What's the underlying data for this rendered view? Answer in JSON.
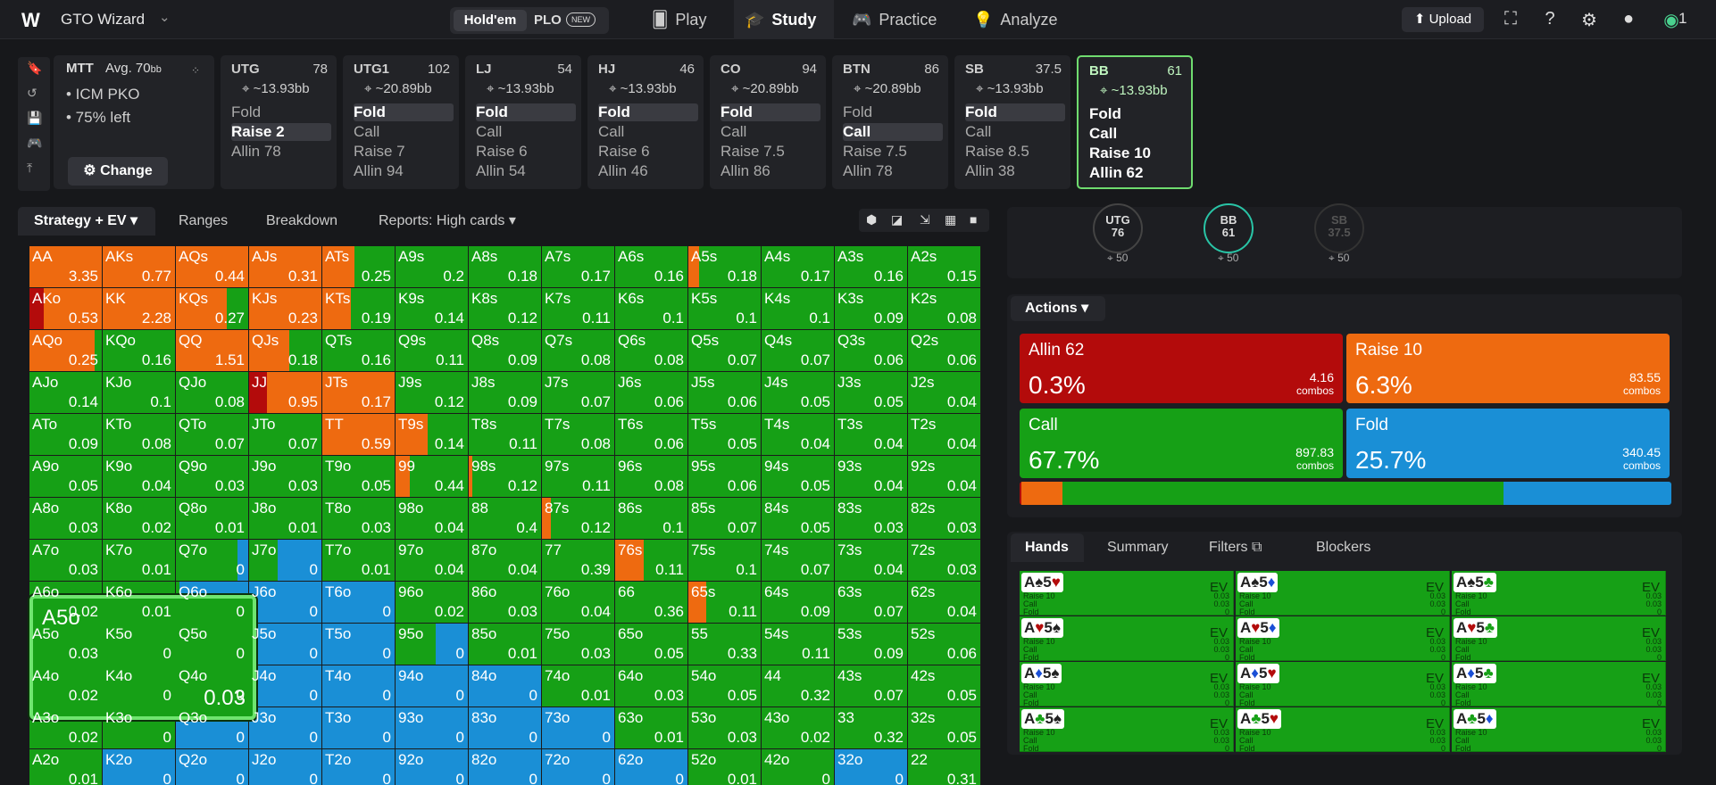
{
  "topbar": {
    "app_name": "GTO Wizard",
    "logo": "W",
    "game_holdem": "Hold'em",
    "game_plo": "PLO",
    "new_badge": "NEW",
    "nav": [
      {
        "label": "Play",
        "icon": "🂠"
      },
      {
        "label": "Study",
        "icon": "🎓"
      },
      {
        "label": "Practice",
        "icon": "🎮"
      },
      {
        "label": "Analyze",
        "icon": "💡"
      }
    ],
    "upload": "Upload",
    "coin_count": "1"
  },
  "mtt": {
    "title": "MTT",
    "avg_label": "Avg. 70",
    "avg_unit": "bb",
    "line1": "• ICM PKO",
    "line2": "• 75% left",
    "change": "Change"
  },
  "seats": [
    {
      "name": "UTG",
      "stack": "78",
      "bb": "~13.93bb",
      "actions": [
        "Fold",
        "Raise 2",
        "Allin 78"
      ],
      "selected": 1
    },
    {
      "name": "UTG1",
      "stack": "102",
      "bb": "~20.89bb",
      "actions": [
        "Fold",
        "Call",
        "Raise 7",
        "Allin 94"
      ],
      "selected": 0
    },
    {
      "name": "LJ",
      "stack": "54",
      "bb": "~13.93bb",
      "actions": [
        "Fold",
        "Call",
        "Raise 6",
        "Allin 54"
      ],
      "selected": 0
    },
    {
      "name": "HJ",
      "stack": "46",
      "bb": "~13.93bb",
      "actions": [
        "Fold",
        "Call",
        "Raise 6",
        "Allin 46"
      ],
      "selected": 0
    },
    {
      "name": "CO",
      "stack": "94",
      "bb": "~20.89bb",
      "actions": [
        "Fold",
        "Call",
        "Raise 7.5",
        "Allin 86"
      ],
      "selected": 0
    },
    {
      "name": "BTN",
      "stack": "86",
      "bb": "~20.89bb",
      "actions": [
        "Fold",
        "Call",
        "Raise 7.5",
        "Allin 78"
      ],
      "selected": 1
    },
    {
      "name": "SB",
      "stack": "37.5",
      "bb": "~13.93bb",
      "actions": [
        "Fold",
        "Call",
        "Raise 8.5",
        "Allin 38"
      ],
      "selected": 0
    },
    {
      "name": "BB",
      "stack": "61",
      "bb": "~13.93bb",
      "actions": [
        "Fold",
        "Call",
        "Raise 10",
        "Allin 62"
      ],
      "selected": -1
    }
  ],
  "tabs": [
    "Strategy + EV",
    "Ranges",
    "Breakdown",
    "Reports: High cards"
  ],
  "colors": {
    "allin": "#b30b0b",
    "raise": "#ee6a10",
    "call": "#16a016",
    "fold": "#1a8fd6"
  },
  "grid": [
    [
      "AA|3.35|R",
      "AKs|0.77|R",
      "AQs|0.44|R",
      "AJs|0.31|R",
      "ATs|0.25|R:0.45,C:0.55",
      "A9s|0.2|C",
      "A8s|0.18|C",
      "A7s|0.17|C",
      "A6s|0.16|C",
      "A5s|0.18|R:0.15,C:0.85",
      "A4s|0.17|C",
      "A3s|0.16|C",
      "A2s|0.15|C"
    ],
    [
      "AKo|0.53|A:0.2,R:0.8",
      "KK|2.28|R",
      "KQs|0.27|R:0.7,C:0.3",
      "KJs|0.23|R",
      "KTs|0.19|R:0.4,C:0.6",
      "K9s|0.14|C",
      "K8s|0.12|C",
      "K7s|0.11|C",
      "K6s|0.1|C",
      "K5s|0.1|C",
      "K4s|0.1|C",
      "K3s|0.09|C",
      "K2s|0.08|C"
    ],
    [
      "AQo|0.25|R:0.9,C:0.1",
      "KQo|0.16|C",
      "QQ|1.51|R",
      "QJs|0.18|R:0.55,C:0.45",
      "QTs|0.16|C",
      "Q9s|0.11|C",
      "Q8s|0.09|C",
      "Q7s|0.08|C",
      "Q6s|0.08|C",
      "Q5s|0.07|C",
      "Q4s|0.07|C",
      "Q3s|0.06|C",
      "Q2s|0.06|C"
    ],
    [
      "AJo|0.14|C",
      "KJo|0.1|C",
      "QJo|0.08|C",
      "JJ|0.95|A:0.25,R:0.75",
      "JTs|0.17|R",
      "J9s|0.12|C",
      "J8s|0.09|C",
      "J7s|0.07|C",
      "J6s|0.06|C",
      "J5s|0.06|C",
      "J4s|0.05|C",
      "J3s|0.05|C",
      "J2s|0.04|C"
    ],
    [
      "ATo|0.09|C",
      "KTo|0.08|C",
      "QTo|0.07|C",
      "JTo|0.07|C",
      "TT|0.59|R",
      "T9s|0.14|R:0.45,C:0.55",
      "T8s|0.11|C",
      "T7s|0.08|C",
      "T6s|0.06|C",
      "T5s|0.05|C",
      "T4s|0.04|C",
      "T3s|0.04|C",
      "T2s|0.04|C"
    ],
    [
      "A9o|0.05|C",
      "K9o|0.04|C",
      "Q9o|0.03|C",
      "J9o|0.03|C",
      "T9o|0.05|C",
      "99|0.44|R:0.2,C:0.8",
      "98s|0.12|R:0.05,C:0.95",
      "97s|0.11|C",
      "96s|0.08|C",
      "95s|0.06|C",
      "94s|0.05|C",
      "93s|0.04|C",
      "92s|0.04|C"
    ],
    [
      "A8o|0.03|C",
      "K8o|0.02|C",
      "Q8o|0.01|C",
      "J8o|0.01|C",
      "T8o|0.03|C",
      "98o|0.04|C",
      "88|0.4|C",
      "87s|0.12|R:0.12,C:0.88",
      "86s|0.1|C",
      "85s|0.07|C",
      "84s|0.05|C",
      "83s|0.03|C",
      "82s|0.03|C"
    ],
    [
      "A7o|0.03|C",
      "K7o|0.01|C",
      "Q7o|0|C:0.85,F:0.15",
      "J7o|0|C:0.4,F:0.6",
      "T7o|0.01|C",
      "97o|0.04|C",
      "87o|0.04|C",
      "77|0.39|C",
      "76s|0.11|R:0.4,C:0.6",
      "75s|0.1|C",
      "74s|0.07|C",
      "73s|0.04|C",
      "72s|0.03|C"
    ],
    [
      "A6o|0.02|C",
      "K6o|0.01|C",
      "Q6o|0|C:0.05,F:0.95",
      "J6o|0|F",
      "T6o|0|F",
      "96o|0.02|C",
      "86o|0.03|C",
      "76o|0.04|C",
      "66|0.36|C",
      "65s|0.11|R:0.25,C:0.75",
      "64s|0.09|C",
      "63s|0.07|C",
      "62s|0.04|C"
    ],
    [
      "A5o|0.03|C",
      "K5o|0|C",
      "Q5o|0|F",
      "J5o|0|F",
      "T5o|0|F",
      "95o|0|C:0.55,F:0.45",
      "85o|0.01|C",
      "75o|0.03|C",
      "65o|0.05|C",
      "55|0.33|C",
      "54s|0.11|C",
      "53s|0.09|C",
      "52s|0.06|C"
    ],
    [
      "A4o|0.02|C",
      "K4o|0|C",
      "Q4o|0|F",
      "J4o|0|F",
      "T4o|0|F",
      "94o|0|F",
      "84o|0|F",
      "74o|0.01|C",
      "64o|0.03|C",
      "54o|0.05|C",
      "44|0.32|C",
      "43s|0.07|C",
      "42s|0.05|C"
    ],
    [
      "A3o|0.02|C",
      "K3o|0|C",
      "Q3o|0|F",
      "J3o|0|F",
      "T3o|0|F",
      "93o|0|F",
      "83o|0|F",
      "73o|0|F",
      "63o|0.01|C",
      "53o|0.03|C",
      "43o|0.02|C",
      "33|0.32|C",
      "32s|0.05|C"
    ],
    [
      "A2o|0.01|C",
      "K2o|0|F",
      "Q2o|0|F",
      "J2o|0|F",
      "T2o|0|F",
      "92o|0|F",
      "82o|0|F",
      "72o|0|F",
      "62o|0|F",
      "52o|0.01|C",
      "42o|0|C",
      "32o|0|F",
      "22|0.31|C"
    ]
  ],
  "popup": {
    "hand": "A5o",
    "ev": "0.03"
  },
  "positions": [
    {
      "name": "UTG",
      "stack": "76",
      "sub": "50"
    },
    {
      "name": "BB",
      "stack": "61",
      "sub": "50"
    },
    {
      "name": "SB",
      "stack": "37.5",
      "sub": "50"
    }
  ],
  "actions": {
    "label": "Actions",
    "cards": [
      {
        "label": "Allin 62",
        "pct": "0.3%",
        "combos": "4.16",
        "combos_label": "combos",
        "freq": 0.003
      },
      {
        "label": "Raise 10",
        "pct": "6.3%",
        "combos": "83.55",
        "combos_label": "combos",
        "freq": 0.063
      },
      {
        "label": "Call",
        "pct": "67.7%",
        "combos": "897.83",
        "combos_label": "combos",
        "freq": 0.677
      },
      {
        "label": "Fold",
        "pct": "25.7%",
        "combos": "340.45",
        "combos_label": "combos",
        "freq": 0.257
      }
    ]
  },
  "hands_tabs": [
    "Hands",
    "Summary",
    "Filters",
    "Blockers"
  ],
  "hands": [
    [
      "A♠5♥",
      "A♠5♦",
      "A♠5♣"
    ],
    [
      "A♥5♠",
      "A♥5♦",
      "A♥5♣"
    ],
    [
      "A♦5♠",
      "A♦5♥",
      "A♦5♣"
    ],
    [
      "A♣5♠",
      "A♣5♥",
      "A♣5♦"
    ]
  ],
  "hand_ev_label": "EV",
  "hand_mini": [
    "Raise 10",
    "Call",
    "Fold"
  ],
  "hand_mini_vals": [
    "0.03",
    "0.03",
    "0"
  ]
}
